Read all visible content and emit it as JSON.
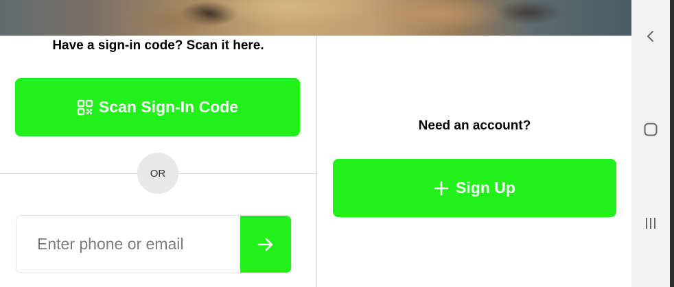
{
  "left": {
    "heading": "Have a sign-in code? Scan it here.",
    "scan_button_label": "Scan Sign-In Code",
    "scan_icon": "qr-code-icon",
    "divider_label": "OR",
    "input": {
      "placeholder": "Enter phone or email",
      "value": ""
    },
    "submit_icon": "arrow-right-icon"
  },
  "right": {
    "heading": "Need an account?",
    "signup_button_label": "Sign Up",
    "signup_icon": "plus-icon"
  },
  "nav_bar": {
    "buttons": [
      "back-icon",
      "home-icon",
      "recents-icon"
    ]
  },
  "colors": {
    "accent_green": "#22f01a",
    "text": "#000000",
    "or_badge_bg": "#e8e8e8"
  }
}
